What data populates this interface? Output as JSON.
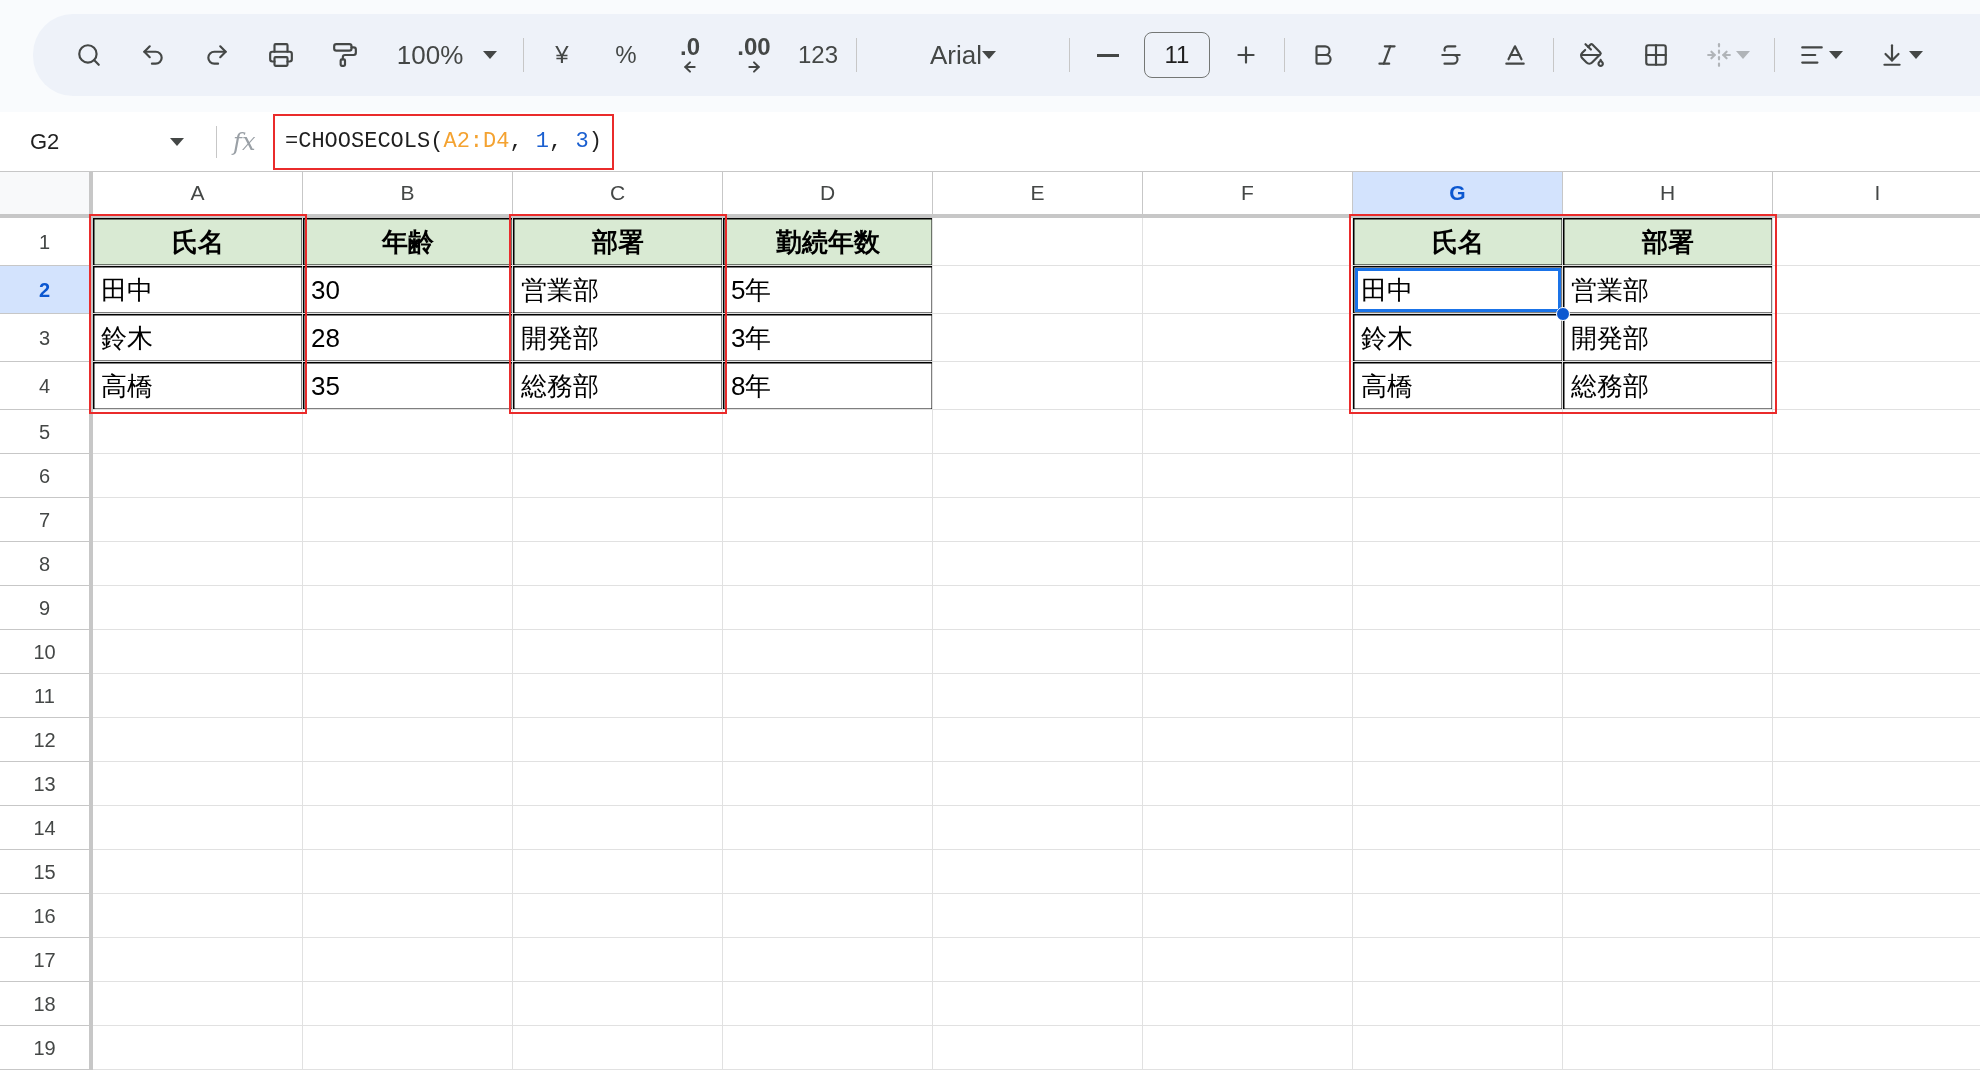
{
  "toolbar": [
    {
      "kind": "search"
    },
    {
      "kind": "undo"
    },
    {
      "kind": "redo"
    },
    {
      "kind": "print"
    },
    {
      "kind": "paintformat"
    },
    {
      "kind": "dropdown",
      "label": "100%"
    },
    {
      "kind": "separator"
    },
    {
      "kind": "text",
      "label": "¥"
    },
    {
      "kind": "text",
      "label": "%"
    },
    {
      "kind": "decrease_decimal",
      "label": ".0"
    },
    {
      "kind": "increase_decimal",
      "label": ".00"
    },
    {
      "kind": "text",
      "label": "123"
    },
    {
      "kind": "separator"
    },
    {
      "kind": "font",
      "label": "Arial"
    },
    {
      "kind": "separator"
    },
    {
      "kind": "minus"
    },
    {
      "kind": "size",
      "label": "11"
    },
    {
      "kind": "plus"
    },
    {
      "kind": "separator"
    },
    {
      "kind": "bold"
    },
    {
      "kind": "italic"
    },
    {
      "kind": "strikethrough"
    },
    {
      "kind": "textcolor"
    },
    {
      "kind": "separator"
    },
    {
      "kind": "fillcolor"
    },
    {
      "kind": "borders"
    },
    {
      "kind": "merge",
      "disabled": true
    },
    {
      "kind": "separator"
    },
    {
      "kind": "align",
      "disabled": false
    },
    {
      "kind": "valign",
      "disabled": false
    }
  ],
  "formula_bar": {
    "name_box": "G2",
    "fx_label": "fx",
    "outlined": true,
    "formula": [
      {
        "text": "=CHOOSECOLS(",
        "kind": "plain"
      },
      {
        "text": "A2:D4",
        "kind": "range"
      },
      {
        "text": ", ",
        "kind": "plain"
      },
      {
        "text": "1",
        "kind": "number"
      },
      {
        "text": ", ",
        "kind": "plain"
      },
      {
        "text": "3",
        "kind": "number"
      },
      {
        "text": ")",
        "kind": "plain"
      }
    ]
  },
  "columns": [
    {
      "label": "A",
      "selected": false,
      "outlined": true
    },
    {
      "label": "B",
      "selected": false,
      "outlined": false
    },
    {
      "label": "C",
      "selected": false,
      "outlined": true
    },
    {
      "label": "D",
      "selected": false,
      "outlined": false
    },
    {
      "label": "E",
      "selected": false,
      "outlined": false
    },
    {
      "label": "F",
      "selected": false,
      "outlined": false
    },
    {
      "label": "G",
      "selected": true,
      "outlined": true
    },
    {
      "label": "H",
      "selected": false,
      "outlined": true
    },
    {
      "label": "I",
      "selected": false,
      "outlined": false
    }
  ],
  "rows": [
    {
      "label": "1",
      "selected": false,
      "cells": [
        {
          "text": "氏名",
          "kind": "header",
          "selected": false
        },
        {
          "text": "年齢",
          "kind": "header",
          "selected": false
        },
        {
          "text": "部署",
          "kind": "header",
          "selected": false
        },
        {
          "text": "勤続年数",
          "kind": "header",
          "selected": false
        },
        null,
        null,
        {
          "text": "氏名",
          "kind": "header",
          "selected": false
        },
        {
          "text": "部署",
          "kind": "header",
          "selected": false
        }
      ]
    },
    {
      "label": "2",
      "selected": true,
      "cells": [
        {
          "text": "田中",
          "kind": "data",
          "selected": false
        },
        {
          "text": "30",
          "kind": "data",
          "selected": false
        },
        {
          "text": "営業部",
          "kind": "data",
          "selected": false
        },
        {
          "text": "5年",
          "kind": "data",
          "selected": false
        },
        null,
        null,
        {
          "text": "田中",
          "kind": "data",
          "selected": true
        },
        {
          "text": "営業部",
          "kind": "data",
          "selected": false
        }
      ]
    },
    {
      "label": "3",
      "selected": false,
      "cells": [
        {
          "text": "鈴木",
          "kind": "data",
          "selected": false
        },
        {
          "text": "28",
          "kind": "data",
          "selected": false
        },
        {
          "text": "開発部",
          "kind": "data",
          "selected": false
        },
        {
          "text": "3年",
          "kind": "data",
          "selected": false
        },
        null,
        null,
        {
          "text": "鈴木",
          "kind": "data",
          "selected": false
        },
        {
          "text": "開発部",
          "kind": "data",
          "selected": false
        }
      ]
    },
    {
      "label": "4",
      "selected": false,
      "cells": [
        {
          "text": "高橋",
          "kind": "data",
          "selected": false
        },
        {
          "text": "35",
          "kind": "data",
          "selected": false
        },
        {
          "text": "総務部",
          "kind": "data",
          "selected": false
        },
        {
          "text": "8年",
          "kind": "data",
          "selected": false
        },
        null,
        null,
        {
          "text": "高橋",
          "kind": "data",
          "selected": false
        },
        {
          "text": "総務部",
          "kind": "data",
          "selected": false
        }
      ]
    },
    {
      "label": "5",
      "selected": false
    },
    {
      "label": "6",
      "selected": false
    },
    {
      "label": "7",
      "selected": false
    },
    {
      "label": "8",
      "selected": false
    },
    {
      "label": "9",
      "selected": false
    },
    {
      "label": "10",
      "selected": false
    },
    {
      "label": "11",
      "selected": false
    },
    {
      "label": "12",
      "selected": false
    },
    {
      "label": "13",
      "selected": false
    },
    {
      "label": "14",
      "selected": false
    },
    {
      "label": "15",
      "selected": false
    },
    {
      "label": "16",
      "selected": false
    },
    {
      "label": "17",
      "selected": false
    },
    {
      "label": "18",
      "selected": false
    },
    {
      "label": "19",
      "selected": false
    }
  ]
}
